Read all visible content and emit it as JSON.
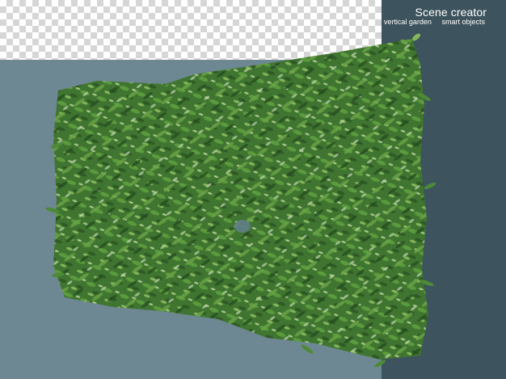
{
  "branding": {
    "title": "Scene creator",
    "subtitle_left": "vertical garden",
    "subtitle_right": "smart objects"
  },
  "colors": {
    "background_transparency_light": "#ffffff",
    "background_transparency_dark": "#d6d6d6",
    "panel_blue_gray": "#6e8893",
    "panel_dark": "#3d535d",
    "foliage_dark": "#2f5a26",
    "foliage_mid": "#4d8a37",
    "foliage_light": "#86b65c"
  },
  "image": {
    "subject": "vertical-garden-plant-wall"
  }
}
